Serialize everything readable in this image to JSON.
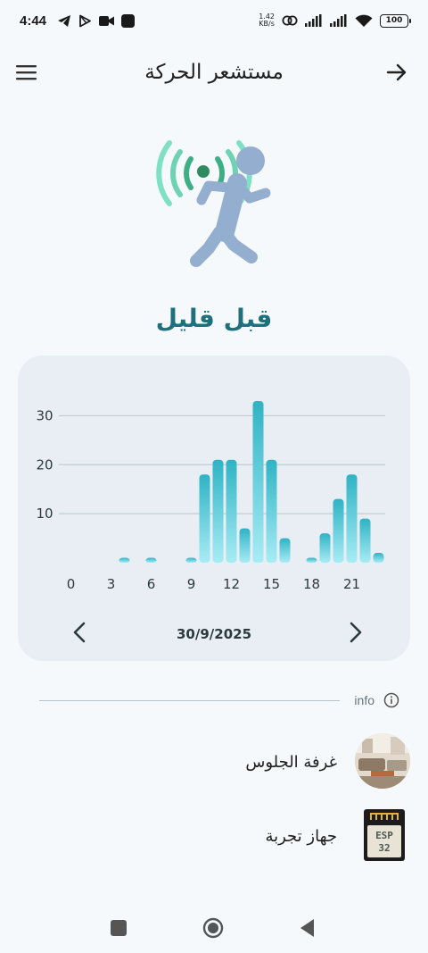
{
  "status_bar": {
    "time": "4:44",
    "net_speed_value": "1.42",
    "net_speed_unit": "KB/s",
    "battery": "100",
    "icons": [
      "telegram-icon",
      "play-icon",
      "video-icon",
      "app-icon",
      "link-icon",
      "signal-icon",
      "signal-icon",
      "wifi-icon",
      "battery-icon"
    ]
  },
  "app_bar": {
    "title": "مستشعر الحركة",
    "menu_icon": "menu-icon",
    "back_icon": "arrow-right-icon"
  },
  "status": {
    "last_motion": "قبل قليل"
  },
  "colors": {
    "accent": "#1f6f7c",
    "bar_top": "#2fb3c4",
    "bar_bottom": "#a8ecf5",
    "figure": "#93aecf",
    "waves": "#7fe0c3",
    "wave_dark": "#2f9a6e"
  },
  "chart_data": {
    "type": "bar",
    "x": [
      0,
      1,
      2,
      3,
      4,
      5,
      6,
      7,
      8,
      9,
      10,
      11,
      12,
      13,
      14,
      15,
      16,
      17,
      18,
      19,
      20,
      21,
      22,
      23
    ],
    "values": [
      0,
      0,
      0,
      0,
      1,
      0,
      1,
      0,
      0,
      1,
      18,
      21,
      21,
      7,
      33,
      21,
      5,
      0,
      1,
      6,
      13,
      18,
      9,
      2
    ],
    "xticks": [
      0,
      3,
      6,
      9,
      12,
      15,
      18,
      21
    ],
    "xtick_labels": [
      "0",
      "3",
      "6",
      "9",
      "12",
      "15",
      "18",
      "21"
    ],
    "yticks": [
      10,
      20,
      30
    ],
    "ytick_labels": [
      "10",
      "20",
      "30"
    ],
    "xlim": [
      -0.5,
      23.5
    ],
    "ylim": [
      0,
      35
    ],
    "grid": true,
    "title": "",
    "xlabel": "",
    "ylabel": ""
  },
  "chart_nav": {
    "date": "30/9/2025",
    "prev_icon": "chevron-left-icon",
    "next_icon": "chevron-right-icon"
  },
  "info_section": {
    "label": "info",
    "items": [
      {
        "label": "غرفة الجلوس",
        "icon": "room-photo"
      },
      {
        "label": "جهاز تجربة",
        "icon": "esp32-chip-icon"
      }
    ]
  },
  "esp_chip": {
    "line1": "ESP",
    "line2": "32"
  }
}
